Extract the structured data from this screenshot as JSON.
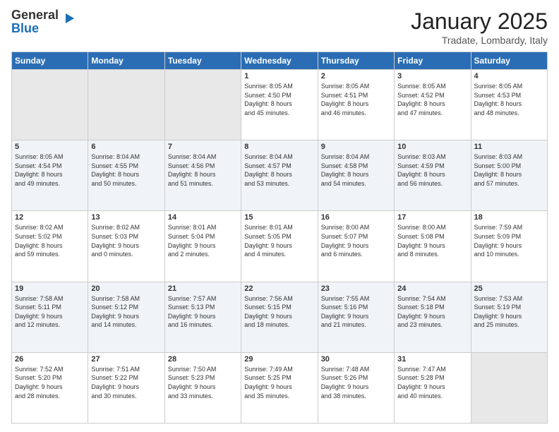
{
  "header": {
    "title": "January 2025",
    "subtitle": "Tradate, Lombardy, Italy"
  },
  "weekdays": [
    "Sunday",
    "Monday",
    "Tuesday",
    "Wednesday",
    "Thursday",
    "Friday",
    "Saturday"
  ],
  "rows": [
    [
      {
        "day": "",
        "info": ""
      },
      {
        "day": "",
        "info": ""
      },
      {
        "day": "",
        "info": ""
      },
      {
        "day": "1",
        "info": "Sunrise: 8:05 AM\nSunset: 4:50 PM\nDaylight: 8 hours\nand 45 minutes."
      },
      {
        "day": "2",
        "info": "Sunrise: 8:05 AM\nSunset: 4:51 PM\nDaylight: 8 hours\nand 46 minutes."
      },
      {
        "day": "3",
        "info": "Sunrise: 8:05 AM\nSunset: 4:52 PM\nDaylight: 8 hours\nand 47 minutes."
      },
      {
        "day": "4",
        "info": "Sunrise: 8:05 AM\nSunset: 4:53 PM\nDaylight: 8 hours\nand 48 minutes."
      }
    ],
    [
      {
        "day": "5",
        "info": "Sunrise: 8:05 AM\nSunset: 4:54 PM\nDaylight: 8 hours\nand 49 minutes."
      },
      {
        "day": "6",
        "info": "Sunrise: 8:04 AM\nSunset: 4:55 PM\nDaylight: 8 hours\nand 50 minutes."
      },
      {
        "day": "7",
        "info": "Sunrise: 8:04 AM\nSunset: 4:56 PM\nDaylight: 8 hours\nand 51 minutes."
      },
      {
        "day": "8",
        "info": "Sunrise: 8:04 AM\nSunset: 4:57 PM\nDaylight: 8 hours\nand 53 minutes."
      },
      {
        "day": "9",
        "info": "Sunrise: 8:04 AM\nSunset: 4:58 PM\nDaylight: 8 hours\nand 54 minutes."
      },
      {
        "day": "10",
        "info": "Sunrise: 8:03 AM\nSunset: 4:59 PM\nDaylight: 8 hours\nand 56 minutes."
      },
      {
        "day": "11",
        "info": "Sunrise: 8:03 AM\nSunset: 5:00 PM\nDaylight: 8 hours\nand 57 minutes."
      }
    ],
    [
      {
        "day": "12",
        "info": "Sunrise: 8:02 AM\nSunset: 5:02 PM\nDaylight: 8 hours\nand 59 minutes."
      },
      {
        "day": "13",
        "info": "Sunrise: 8:02 AM\nSunset: 5:03 PM\nDaylight: 9 hours\nand 0 minutes."
      },
      {
        "day": "14",
        "info": "Sunrise: 8:01 AM\nSunset: 5:04 PM\nDaylight: 9 hours\nand 2 minutes."
      },
      {
        "day": "15",
        "info": "Sunrise: 8:01 AM\nSunset: 5:05 PM\nDaylight: 9 hours\nand 4 minutes."
      },
      {
        "day": "16",
        "info": "Sunrise: 8:00 AM\nSunset: 5:07 PM\nDaylight: 9 hours\nand 6 minutes."
      },
      {
        "day": "17",
        "info": "Sunrise: 8:00 AM\nSunset: 5:08 PM\nDaylight: 9 hours\nand 8 minutes."
      },
      {
        "day": "18",
        "info": "Sunrise: 7:59 AM\nSunset: 5:09 PM\nDaylight: 9 hours\nand 10 minutes."
      }
    ],
    [
      {
        "day": "19",
        "info": "Sunrise: 7:58 AM\nSunset: 5:11 PM\nDaylight: 9 hours\nand 12 minutes."
      },
      {
        "day": "20",
        "info": "Sunrise: 7:58 AM\nSunset: 5:12 PM\nDaylight: 9 hours\nand 14 minutes."
      },
      {
        "day": "21",
        "info": "Sunrise: 7:57 AM\nSunset: 5:13 PM\nDaylight: 9 hours\nand 16 minutes."
      },
      {
        "day": "22",
        "info": "Sunrise: 7:56 AM\nSunset: 5:15 PM\nDaylight: 9 hours\nand 18 minutes."
      },
      {
        "day": "23",
        "info": "Sunrise: 7:55 AM\nSunset: 5:16 PM\nDaylight: 9 hours\nand 21 minutes."
      },
      {
        "day": "24",
        "info": "Sunrise: 7:54 AM\nSunset: 5:18 PM\nDaylight: 9 hours\nand 23 minutes."
      },
      {
        "day": "25",
        "info": "Sunrise: 7:53 AM\nSunset: 5:19 PM\nDaylight: 9 hours\nand 25 minutes."
      }
    ],
    [
      {
        "day": "26",
        "info": "Sunrise: 7:52 AM\nSunset: 5:20 PM\nDaylight: 9 hours\nand 28 minutes."
      },
      {
        "day": "27",
        "info": "Sunrise: 7:51 AM\nSunset: 5:22 PM\nDaylight: 9 hours\nand 30 minutes."
      },
      {
        "day": "28",
        "info": "Sunrise: 7:50 AM\nSunset: 5:23 PM\nDaylight: 9 hours\nand 33 minutes."
      },
      {
        "day": "29",
        "info": "Sunrise: 7:49 AM\nSunset: 5:25 PM\nDaylight: 9 hours\nand 35 minutes."
      },
      {
        "day": "30",
        "info": "Sunrise: 7:48 AM\nSunset: 5:26 PM\nDaylight: 9 hours\nand 38 minutes."
      },
      {
        "day": "31",
        "info": "Sunrise: 7:47 AM\nSunset: 5:28 PM\nDaylight: 9 hours\nand 40 minutes."
      },
      {
        "day": "",
        "info": ""
      }
    ]
  ]
}
